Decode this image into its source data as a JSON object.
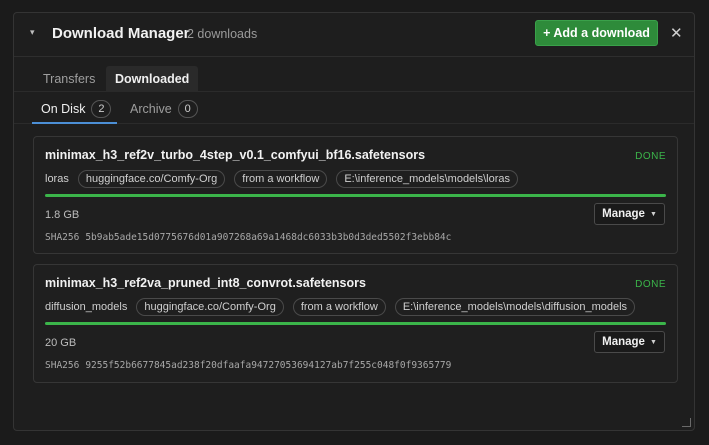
{
  "header": {
    "collapse_icon": "▾",
    "title": "Download Manager",
    "count": "2 downloads",
    "add_label": "+ Add a download",
    "close_icon": "✕"
  },
  "tabs": [
    {
      "label": "Transfers"
    },
    {
      "label": "Downloaded"
    }
  ],
  "subtabs": [
    {
      "label": "On Disk",
      "count": "2"
    },
    {
      "label": "Archive",
      "count": "0"
    }
  ],
  "downloads": [
    {
      "filename": "minimax_h3_ref2v_turbo_4step_v0.1_comfyui_bf16.safetensors",
      "status": "DONE",
      "category": "loras",
      "source": "huggingface.co/Comfy-Org",
      "origin": "from a workflow",
      "path": "E:\\inference_models\\models\\loras",
      "progress": 1.0,
      "size": "1.8 GB",
      "manage_label": "Manage",
      "sha_label": "SHA256",
      "sha": "5b9ab5ade15d0775676d01a907268a69a1468dc6033b3b0d3ded5502f3ebb84c"
    },
    {
      "filename": "minimax_h3_ref2va_pruned_int8_convrot.safetensors",
      "status": "DONE",
      "category": "diffusion_models",
      "source": "huggingface.co/Comfy-Org",
      "origin": "from a workflow",
      "path": "E:\\inference_models\\models\\diffusion_models",
      "progress": 1.0,
      "size": "20 GB",
      "manage_label": "Manage",
      "sha_label": "SHA256",
      "sha": "9255f52b6677845ad238f20dfaafa94727053694127ab7f255c048f0f9365779"
    }
  ],
  "colors": {
    "accent_green": "#2e8b3a",
    "status_done": "#3bb54a",
    "tab_underline": "#4c8fd6"
  }
}
